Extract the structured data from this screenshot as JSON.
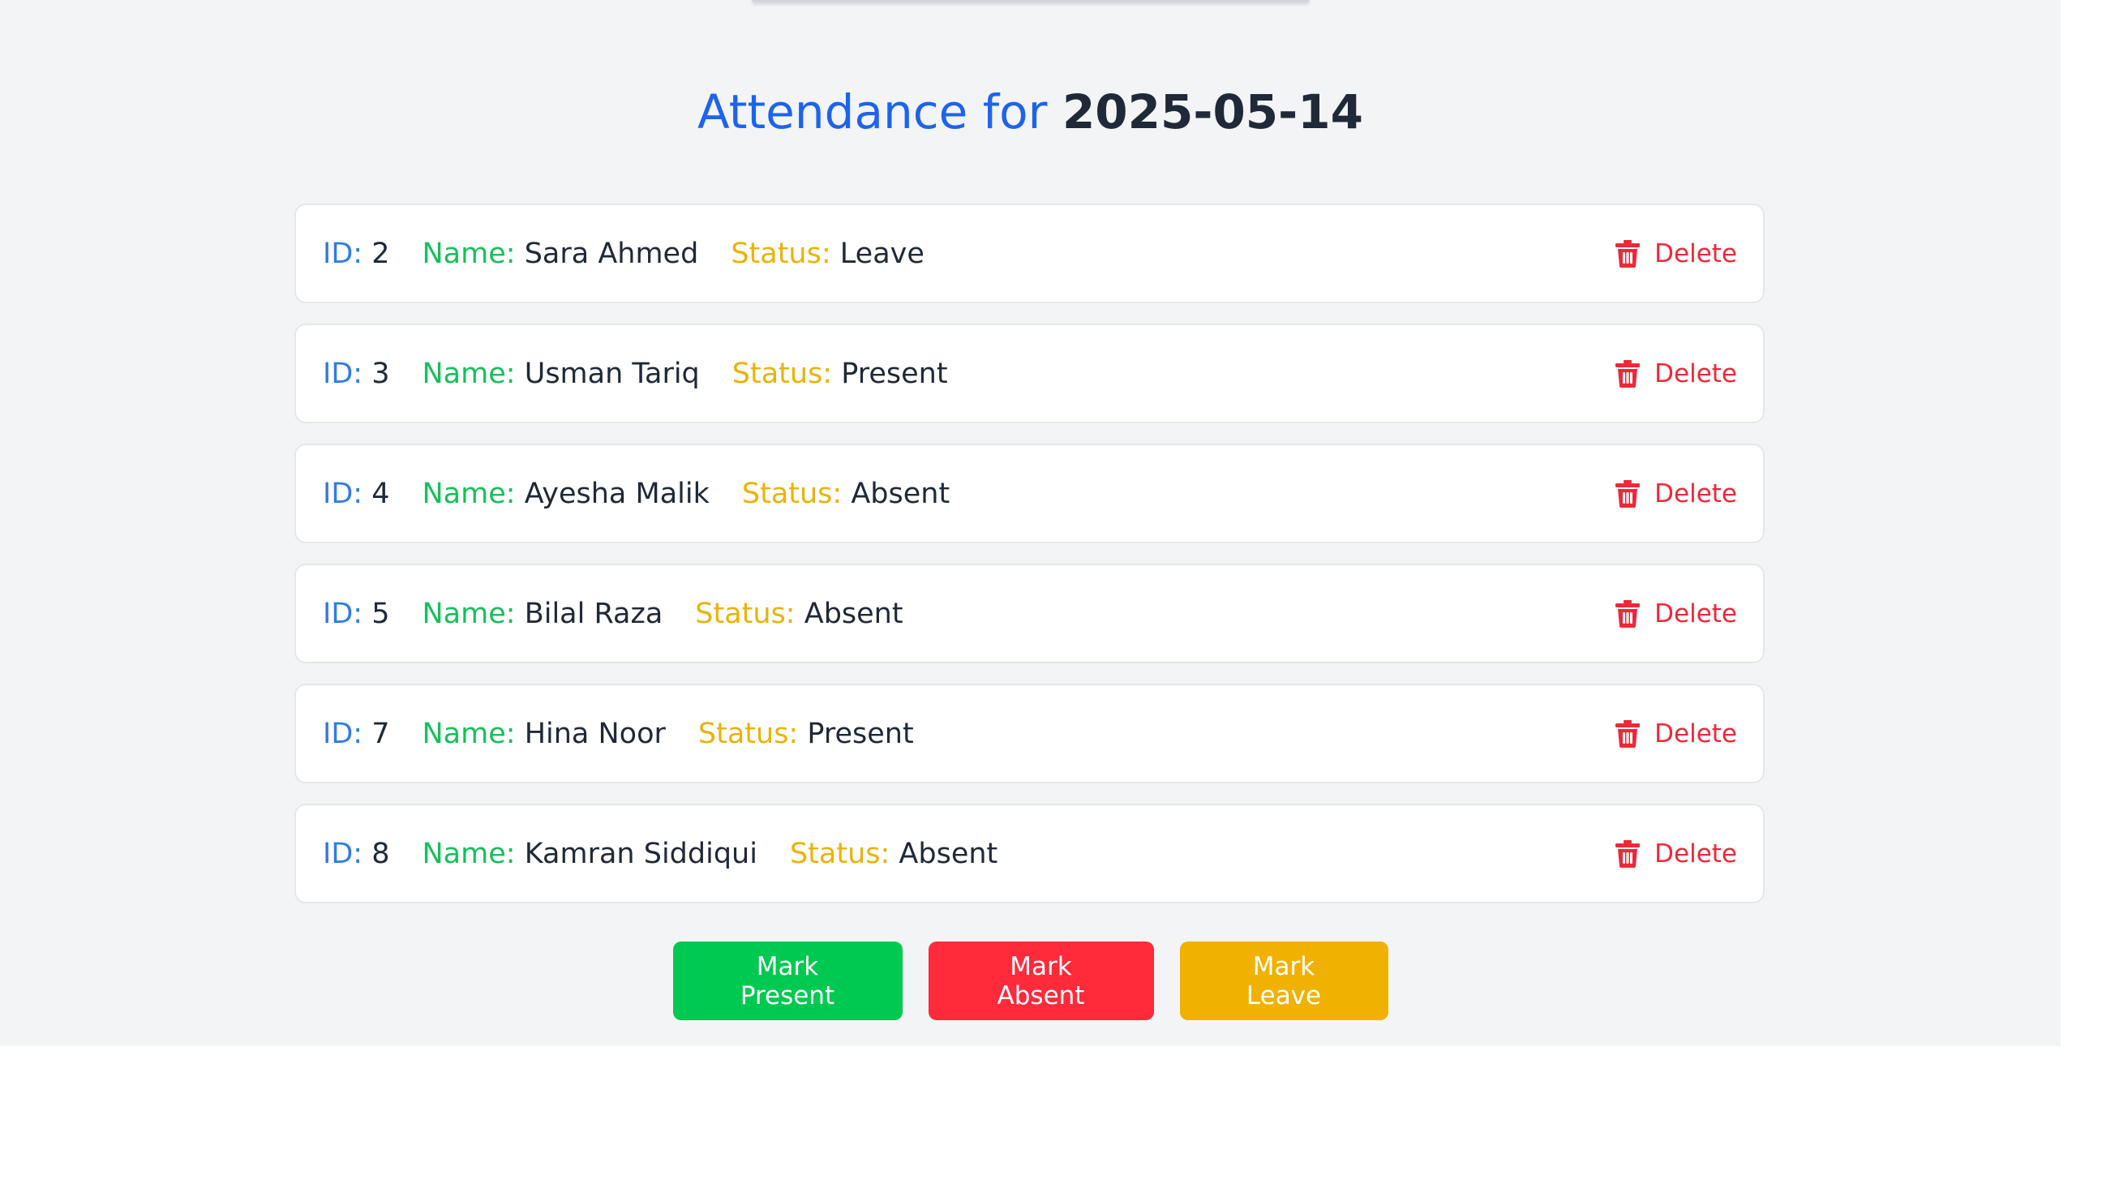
{
  "page": {
    "title_lead": "Attendance for",
    "title_date": "2025-05-14"
  },
  "labels": {
    "id": "ID:",
    "name": "Name:",
    "status": "Status:",
    "delete": "Delete"
  },
  "records": [
    {
      "id": "2",
      "name": "Sara Ahmed",
      "status": "Leave"
    },
    {
      "id": "3",
      "name": "Usman Tariq",
      "status": "Present"
    },
    {
      "id": "4",
      "name": "Ayesha Malik",
      "status": "Absent"
    },
    {
      "id": "5",
      "name": "Bilal Raza",
      "status": "Absent"
    },
    {
      "id": "7",
      "name": "Hina Noor",
      "status": "Present"
    },
    {
      "id": "8",
      "name": "Kamran Siddiqui",
      "status": "Absent"
    }
  ],
  "actions": {
    "mark_present": "Mark Present",
    "mark_absent": "Mark Absent",
    "mark_leave": "Mark Leave"
  },
  "colors": {
    "accent_blue": "#1d63ed",
    "present_green": "#00c951",
    "absent_red": "#ff2a3a",
    "leave_yellow": "#f0b100"
  }
}
